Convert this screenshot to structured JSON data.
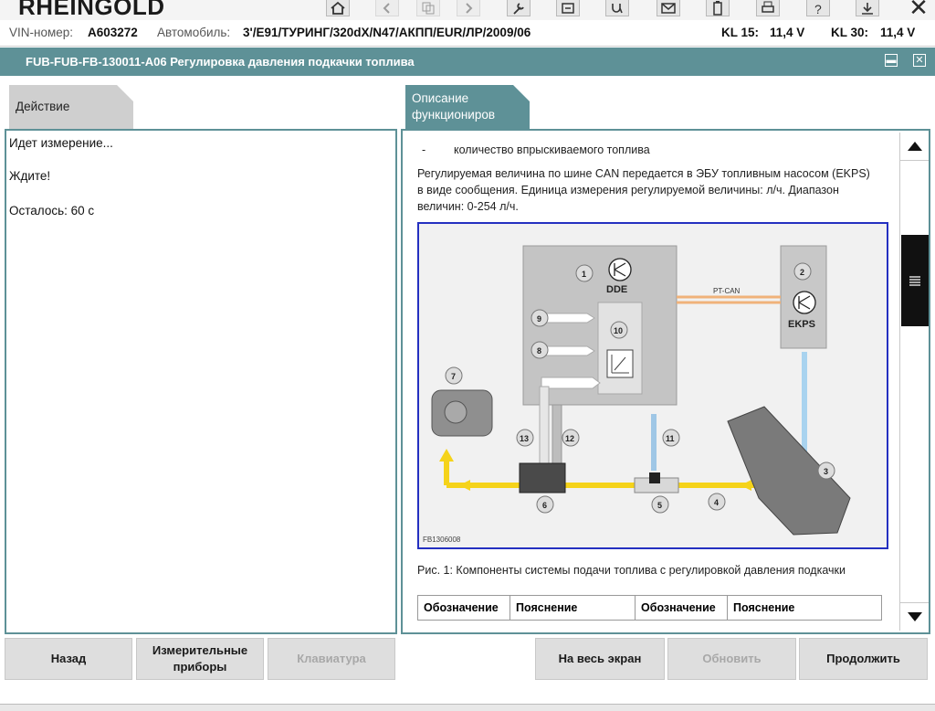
{
  "app": {
    "brand": "RHEINGOLD"
  },
  "info": {
    "vin_label": "VIN-номер:",
    "vin_value": "A603272",
    "car_label": "Автомобиль:",
    "car_value": "3'/E91/ТУРИНГ/320dX/N47/АКПП/EUR/ЛР/2009/06",
    "kl15_label": "KL 15:",
    "kl15_value": "11,4 V",
    "kl30_label": "KL 30:",
    "kl30_value": "11,4 V"
  },
  "window": {
    "title": "FUB-FUB-FB-130011-A06 Регулировка давления подкачки топлива"
  },
  "tabs": {
    "left": "Действие",
    "right": "Описание функциониров"
  },
  "left_panel": {
    "line1": "Идет измерение...",
    "line2": "Ждите!",
    "line3": "Осталось: 60 с"
  },
  "description": {
    "bullet_dash": "-",
    "bullet_text": "количество впрыскиваемого топлива",
    "paragraph": "Регулируемая величина по шине CAN передается в ЭБУ топливным насосом (EKPS) в виде сообщения. Единица измерения регулируемой величины: л/ч. Диапазон величин: 0-254 л/ч.",
    "figure_caption": "Рис. 1: Компоненты системы подачи топлива с регулировкой давления подкачки",
    "table_headers": [
      "Обозначение",
      "Пояснение",
      "Обозначение",
      "Пояснение"
    ]
  },
  "figure": {
    "dde_label": "DDE",
    "ekps_label": "EKPS",
    "bus_label": "PT-CAN",
    "image_id": "FB1306008",
    "numbers": [
      "1",
      "2",
      "3",
      "4",
      "5",
      "6",
      "7",
      "8",
      "9",
      "10",
      "11",
      "12",
      "13"
    ]
  },
  "buttons": {
    "back": "Назад",
    "measure": "Измерительные приборы",
    "keyboard": "Клавиатура",
    "fullscreen": "На весь экран",
    "refresh": "Обновить",
    "continue": "Продолжить"
  },
  "colors": {
    "teal": "#5e9197",
    "figure_border": "#2430c0",
    "fuel_line": "#f5d31a"
  }
}
